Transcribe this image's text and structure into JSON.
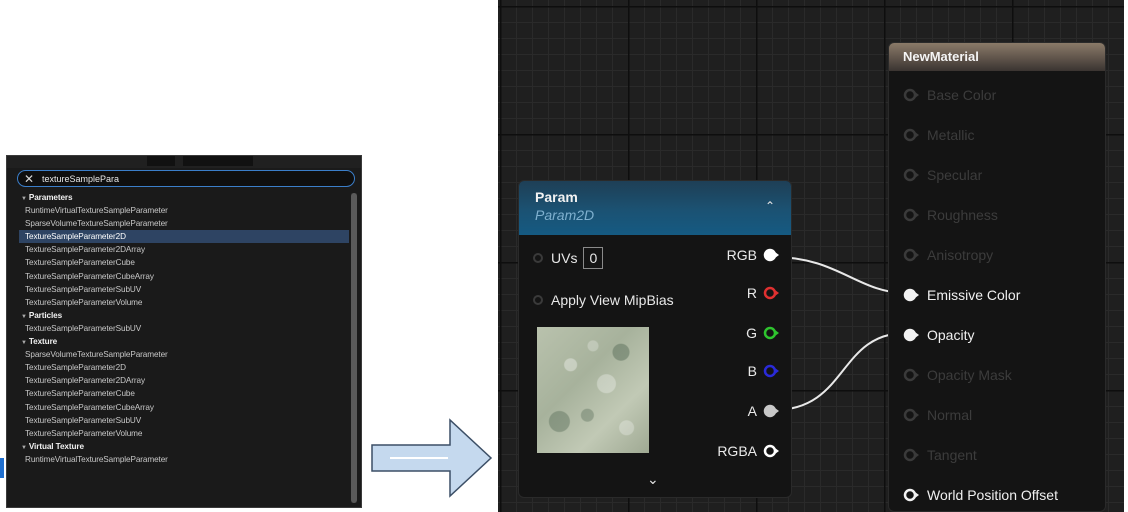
{
  "search_panel": {
    "query": "textureSamplePara",
    "rows": [
      {
        "type": "category",
        "label": "Parameters"
      },
      {
        "type": "item",
        "label": "RuntimeVirtualTextureSampleParameter"
      },
      {
        "type": "item",
        "label": "SparseVolumeTextureSampleParameter"
      },
      {
        "type": "item",
        "label": "TextureSampleParameter2D",
        "selected": true
      },
      {
        "type": "item",
        "label": "TextureSampleParameter2DArray"
      },
      {
        "type": "item",
        "label": "TextureSampleParameterCube"
      },
      {
        "type": "item",
        "label": "TextureSampleParameterCubeArray"
      },
      {
        "type": "item",
        "label": "TextureSampleParameterSubUV"
      },
      {
        "type": "item",
        "label": "TextureSampleParameterVolume"
      },
      {
        "type": "category",
        "label": "Particles"
      },
      {
        "type": "item",
        "label": "TextureSampleParameterSubUV"
      },
      {
        "type": "category",
        "label": "Texture"
      },
      {
        "type": "item",
        "label": "SparseVolumeTextureSampleParameter"
      },
      {
        "type": "item",
        "label": "TextureSampleParameter2D"
      },
      {
        "type": "item",
        "label": "TextureSampleParameter2DArray"
      },
      {
        "type": "item",
        "label": "TextureSampleParameterCube"
      },
      {
        "type": "item",
        "label": "TextureSampleParameterCubeArray"
      },
      {
        "type": "item",
        "label": "TextureSampleParameterSubUV"
      },
      {
        "type": "item",
        "label": "TextureSampleParameterVolume"
      },
      {
        "type": "category",
        "label": "Virtual Texture"
      },
      {
        "type": "item",
        "label": "RuntimeVirtualTextureSampleParameter"
      }
    ]
  },
  "param_node": {
    "title": "Param",
    "subtitle": "Param2D",
    "uvs_label": "UVs",
    "uvs_value": "0",
    "apply_mip_label": "Apply View MipBias",
    "outputs": [
      {
        "label": "RGB",
        "color": "#ffffff"
      },
      {
        "label": "R",
        "color": "#e03030"
      },
      {
        "label": "G",
        "color": "#2ec42e"
      },
      {
        "label": "B",
        "color": "#2a2ad8"
      },
      {
        "label": "A",
        "color": "#c8c8c8"
      },
      {
        "label": "RGBA",
        "color": "#ffffff"
      }
    ]
  },
  "material_node": {
    "title": "NewMaterial",
    "inputs": [
      {
        "label": "Base Color",
        "active": false
      },
      {
        "label": "Metallic",
        "active": false
      },
      {
        "label": "Specular",
        "active": false
      },
      {
        "label": "Roughness",
        "active": false
      },
      {
        "label": "Anisotropy",
        "active": false
      },
      {
        "label": "Emissive Color",
        "active": true
      },
      {
        "label": "Opacity",
        "active": true
      },
      {
        "label": "Opacity Mask",
        "active": false
      },
      {
        "label": "Normal",
        "active": false
      },
      {
        "label": "Tangent",
        "active": false
      },
      {
        "label": "World Position Offset",
        "active": true
      }
    ]
  },
  "colors": {
    "selection": "#2e4463",
    "search_border": "#3b7ec9",
    "arrow_fill": "#c5d9ee",
    "arrow_stroke": "#3c4f66"
  }
}
